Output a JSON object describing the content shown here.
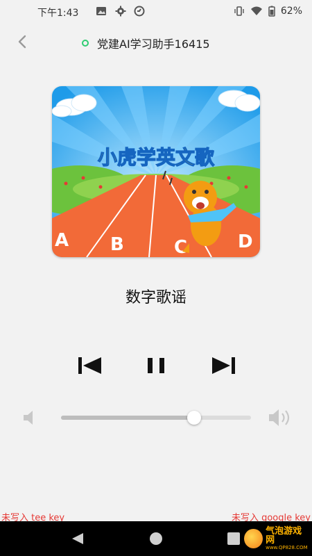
{
  "status": {
    "time": "下午1:43",
    "battery": "62%"
  },
  "header": {
    "title": "党建AI学习助手16415"
  },
  "cover": {
    "title": "小虎学英文歌",
    "letters": [
      "A",
      "B",
      "C",
      "D"
    ]
  },
  "player": {
    "song_title": "数字歌谣",
    "volume_level": 0.7
  },
  "footer": {
    "warn_left": "未写入 tee key",
    "warn_right": "未写入 google key"
  },
  "watermark": {
    "text": "气泡游戏网",
    "sub": "www.QP828.COM"
  }
}
